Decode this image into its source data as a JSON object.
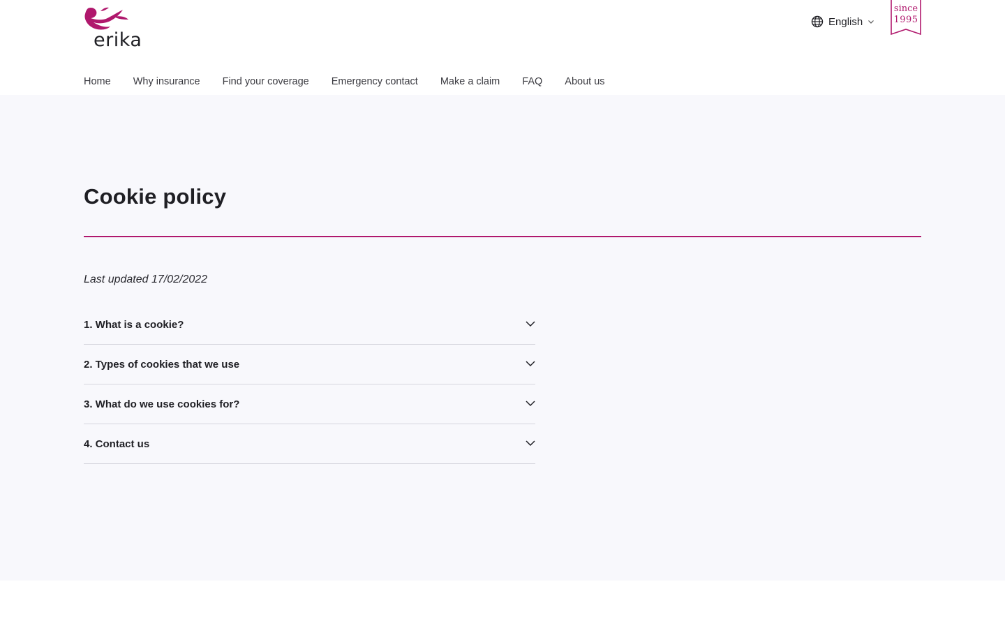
{
  "brand": {
    "name": "erika",
    "badge_top": "since",
    "badge_bottom": "1995",
    "color": "#b0186d"
  },
  "language": {
    "label": "English",
    "icon": "globe-icon"
  },
  "nav": {
    "items": [
      {
        "label": "Home"
      },
      {
        "label": "Why insurance"
      },
      {
        "label": "Find your coverage"
      },
      {
        "label": "Emergency contact"
      },
      {
        "label": "Make a claim"
      },
      {
        "label": "FAQ"
      },
      {
        "label": "About us"
      }
    ]
  },
  "page": {
    "title": "Cookie policy",
    "last_updated": "Last updated 17/02/2022"
  },
  "accordion": {
    "items": [
      {
        "label": "1. What is a cookie?"
      },
      {
        "label": "2. Types of cookies that we use"
      },
      {
        "label": "3. What do we use cookies for?"
      },
      {
        "label": "4. Contact us"
      }
    ],
    "icon": "chevron-down-icon"
  }
}
